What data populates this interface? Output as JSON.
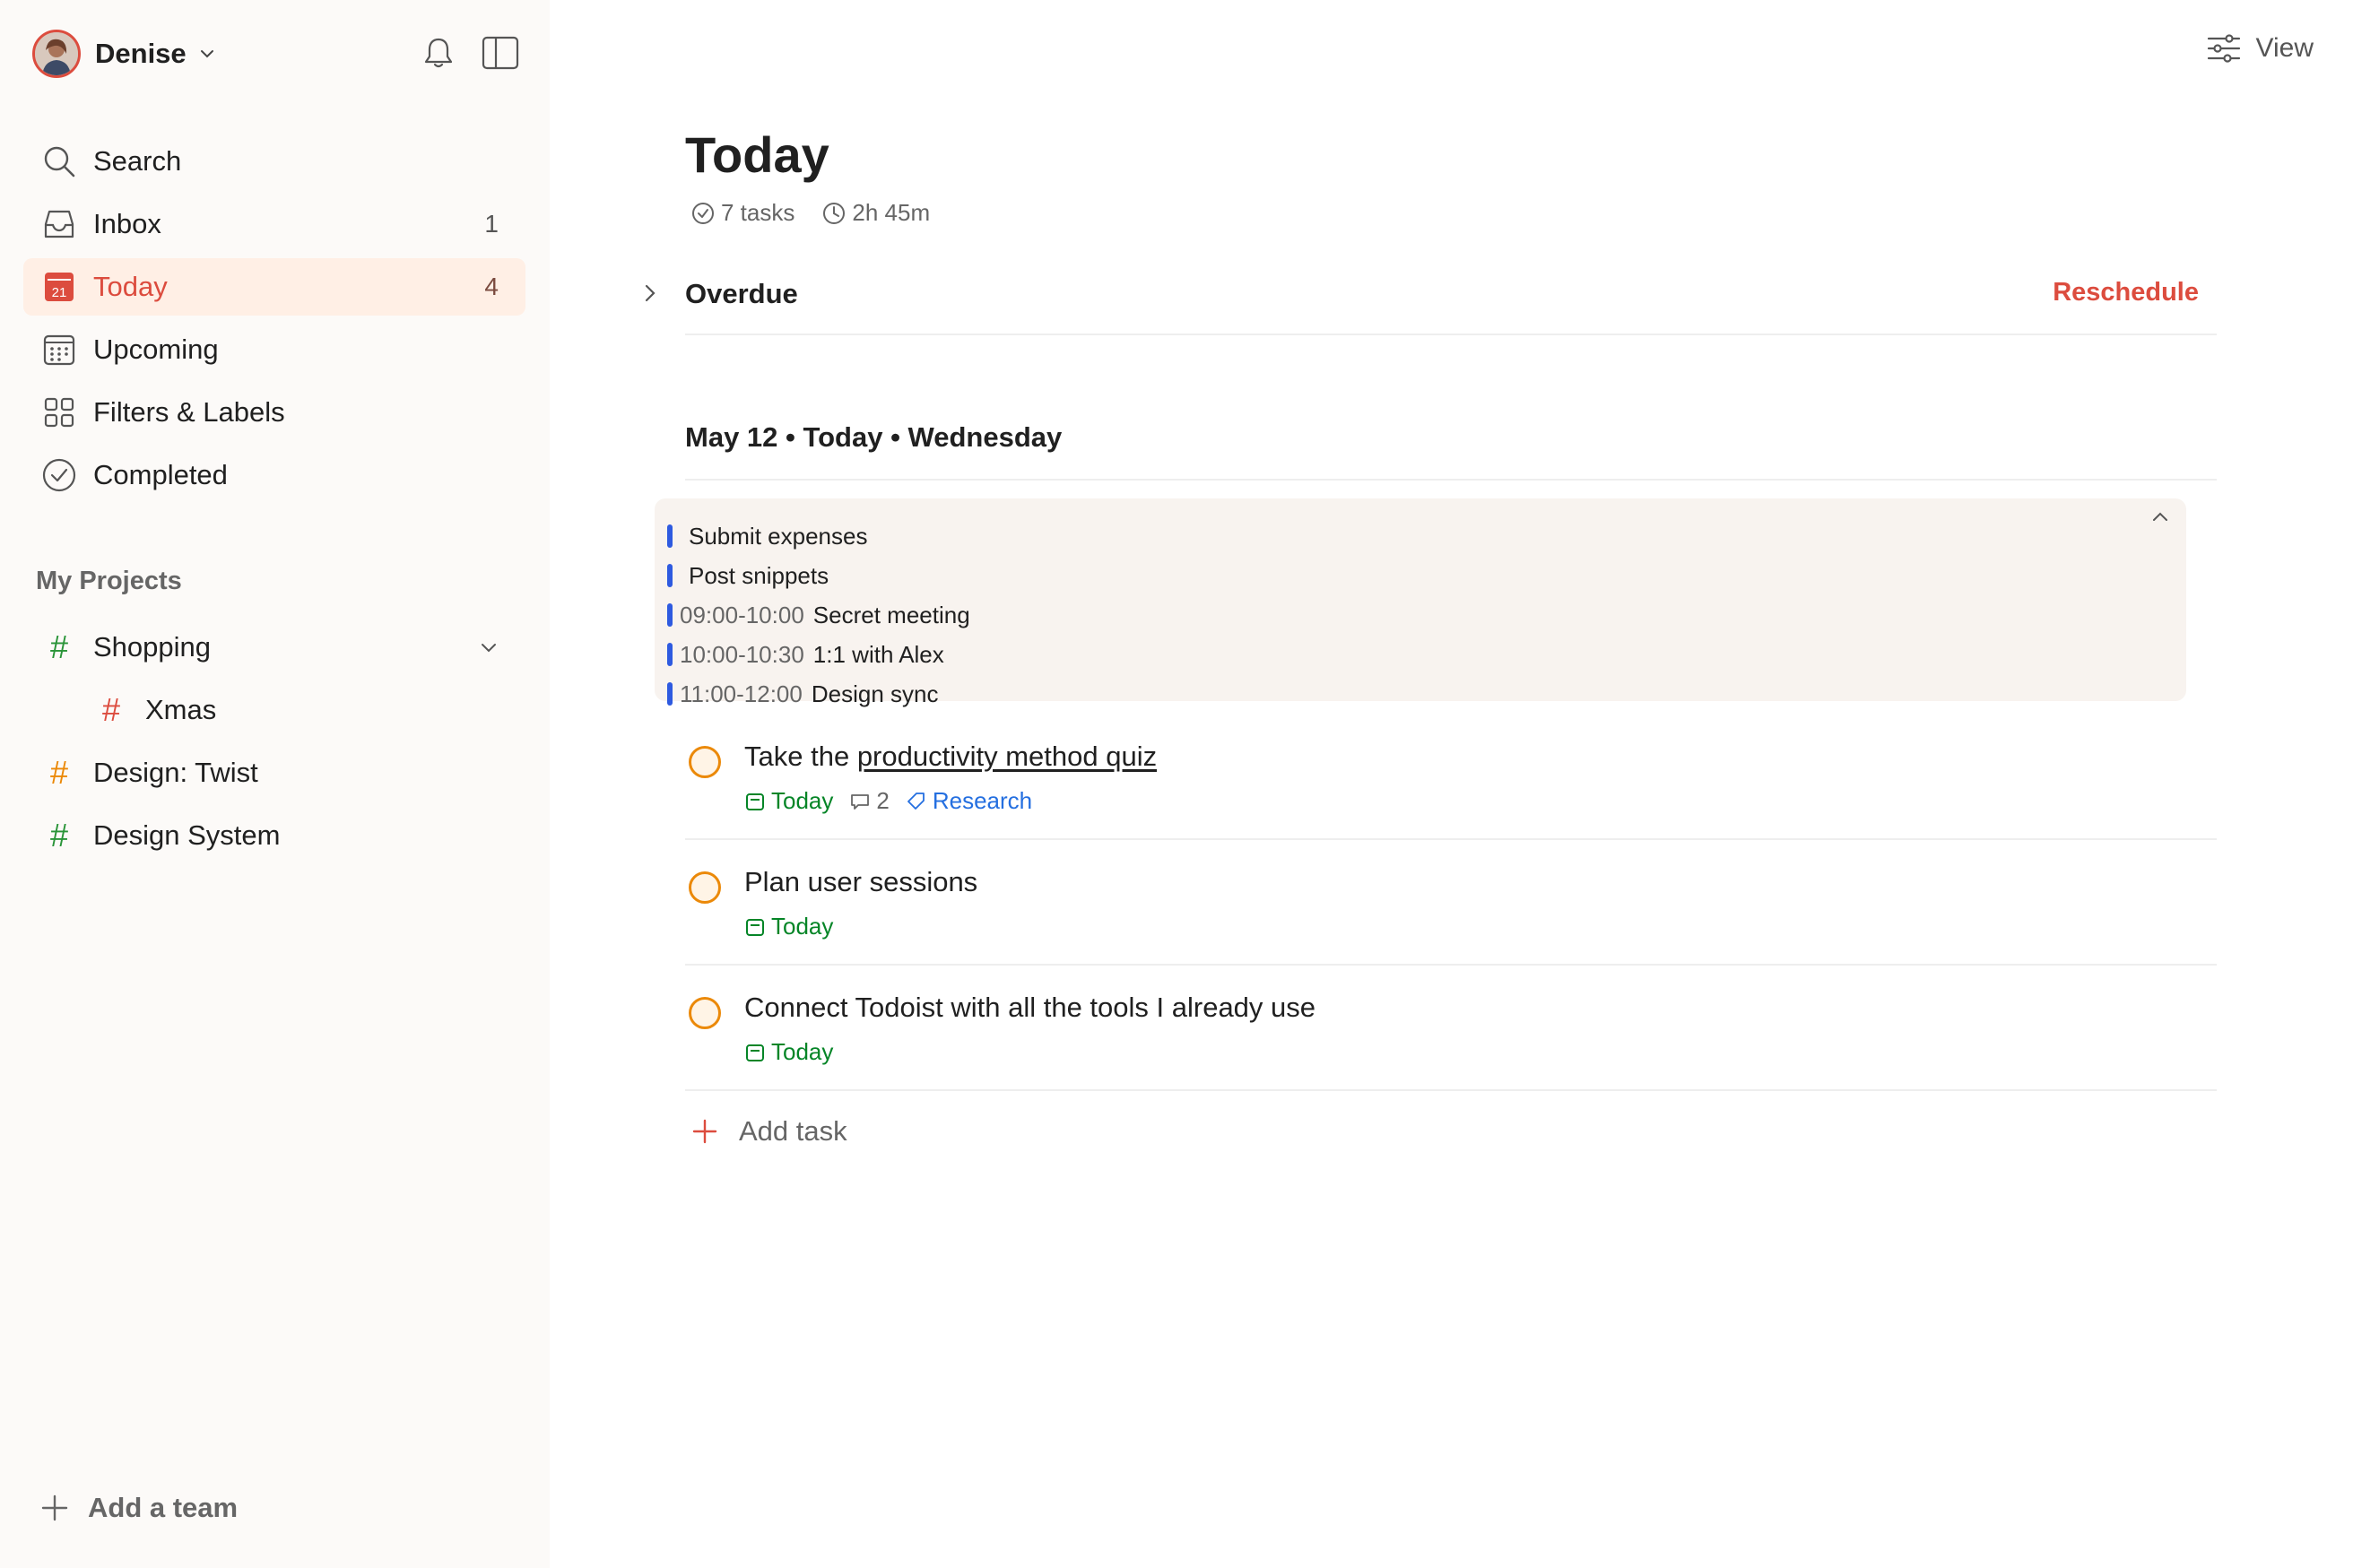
{
  "sidebar": {
    "user": {
      "name": "Denise"
    },
    "nav": [
      {
        "label": "Search",
        "count": ""
      },
      {
        "label": "Inbox",
        "count": "1"
      },
      {
        "label": "Today",
        "count": "4",
        "icon_number": "21"
      },
      {
        "label": "Upcoming",
        "count": ""
      },
      {
        "label": "Filters & Labels",
        "count": ""
      },
      {
        "label": "Completed",
        "count": ""
      }
    ],
    "projects_heading": "My Projects",
    "projects": [
      {
        "label": "Shopping",
        "hash": "#",
        "color": "#299438"
      },
      {
        "label": "Xmas",
        "hash": "#",
        "color": "#dc4c3e"
      },
      {
        "label": "Design: Twist",
        "hash": "#",
        "color": "#eb8909"
      },
      {
        "label": "Design System",
        "hash": "#",
        "color": "#299438"
      }
    ],
    "add_team": "Add a team"
  },
  "header": {
    "view_label": "View"
  },
  "main": {
    "title": "Today",
    "meta": {
      "tasks": "7 tasks",
      "duration": "2h 45m"
    },
    "overdue": {
      "label": "Overdue",
      "action": "Reschedule"
    },
    "date_heading": "May 12 • Today • Wednesday",
    "calendar_events": [
      {
        "time": "",
        "title": "Submit expenses"
      },
      {
        "time": "",
        "title": "Post snippets"
      },
      {
        "time": "09:00-10:00",
        "title": "Secret meeting"
      },
      {
        "time": "10:00-10:30",
        "title": "1:1 with Alex"
      },
      {
        "time": "11:00-12:00",
        "title": "Design sync"
      }
    ],
    "tasks": [
      {
        "prefix": "Take the ",
        "link": "productivity method quiz",
        "date": "Today",
        "comments": "2",
        "label": "Research"
      },
      {
        "title": "Plan user sessions",
        "date": "Today"
      },
      {
        "title": "Connect Todoist with all the tools I already use",
        "date": "Today"
      }
    ],
    "add_task": "Add task"
  },
  "colors": {
    "accent": "#dc4c3e",
    "priority_orange": "#eb8909",
    "date_green": "#058527",
    "label_blue": "#246fe0",
    "calendar_bar": "#2e5ae0"
  }
}
